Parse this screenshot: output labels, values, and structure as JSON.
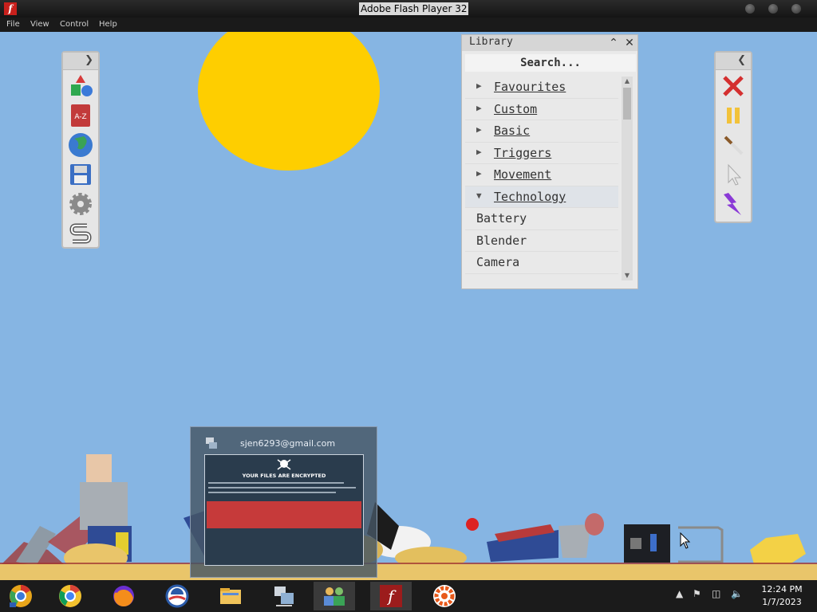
{
  "window": {
    "title": "Adobe Flash Player 32",
    "app_icon_glyph": "f"
  },
  "menu": [
    "File",
    "View",
    "Control",
    "Help"
  ],
  "left_toolbar": {
    "tools": [
      "shapes-icon",
      "a-z-book-icon",
      "globe-icon",
      "save-disk-icon",
      "gear-icon",
      "s-logo-icon"
    ],
    "book_text": "A-Z"
  },
  "right_toolbar": {
    "tools": [
      "delete-x-icon",
      "pause-icon",
      "knife-icon",
      "cursor-icon",
      "lightning-icon"
    ]
  },
  "library": {
    "title": "Library",
    "search_placeholder": "Search...",
    "categories": [
      {
        "label": "Favourites",
        "expanded": false
      },
      {
        "label": "Custom ",
        "expanded": false
      },
      {
        "label": "Basic",
        "expanded": false
      },
      {
        "label": "Triggers",
        "expanded": false
      },
      {
        "label": "Movement ",
        "expanded": false
      },
      {
        "label": "Technology",
        "expanded": true
      }
    ],
    "items": [
      "Battery",
      "Blender",
      "Camera"
    ]
  },
  "preview_popup": {
    "title": "sjen6293@gmail.com",
    "thumbnail_heading": "YOUR FILES ARE ENCRYPTED"
  },
  "taskbar": {
    "apps": [
      "chrome-canary-icon",
      "chrome-icon",
      "firefox-icon",
      "obama-icon",
      "file-explorer-icon",
      "network-computer-icon",
      "users-icon",
      "flash-player-icon",
      "orange-gear-icon"
    ],
    "time": "12:24 PM",
    "date": "1/7/2023"
  },
  "colors": {
    "sky": "#86b5e3",
    "sun": "#fece00",
    "sand": "#e9c56a",
    "blood": "#a23a33"
  }
}
